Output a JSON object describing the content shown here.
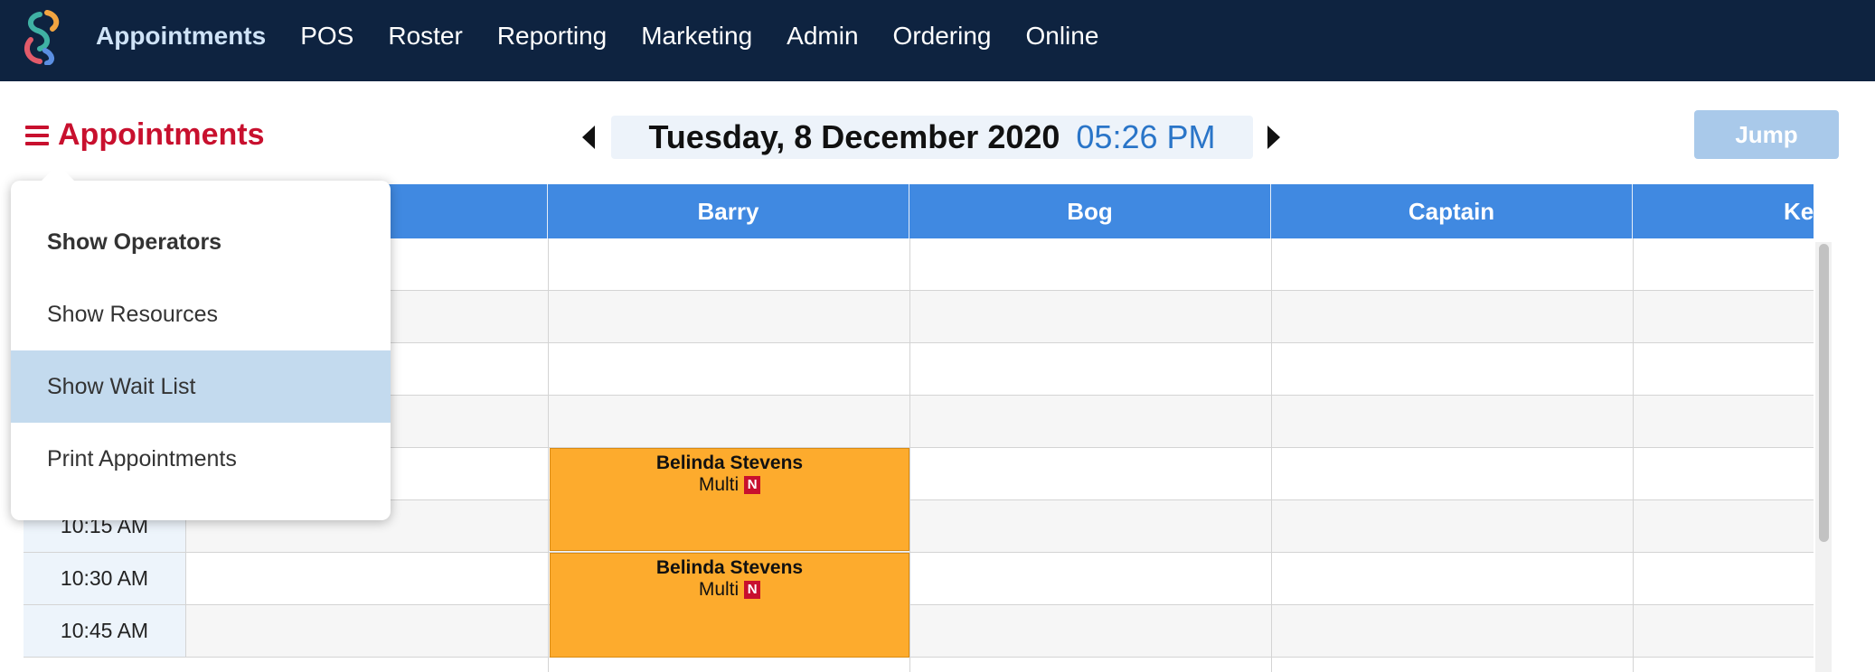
{
  "nav": {
    "items": [
      {
        "label": "Appointments",
        "active": true
      },
      {
        "label": "POS"
      },
      {
        "label": "Roster"
      },
      {
        "label": "Reporting"
      },
      {
        "label": "Marketing"
      },
      {
        "label": "Admin"
      },
      {
        "label": "Ordering"
      },
      {
        "label": "Online"
      }
    ]
  },
  "header": {
    "title": "Appointments",
    "date": "Tuesday, 8 December 2020",
    "time": "05:26 PM",
    "jump_label": "Jump"
  },
  "dropdown": {
    "items": [
      {
        "label": "Show Operators",
        "bold": true
      },
      {
        "label": "Show Resources"
      },
      {
        "label": "Show Wait List",
        "highlighted": true
      },
      {
        "label": "Print Appointments"
      }
    ]
  },
  "calendar": {
    "columns": [
      "",
      "Barry",
      "Bog",
      "Captain",
      "Keith"
    ],
    "times": [
      "",
      "",
      "",
      "",
      "",
      "10:15 AM",
      "10:30 AM",
      "10:45 AM"
    ],
    "appointments": [
      {
        "operator": "Barry",
        "client": "Belinda Stevens",
        "service": "Multi",
        "badge": "N"
      },
      {
        "operator": "Barry",
        "client": "Belinda Stevens",
        "service": "Multi",
        "badge": "N"
      }
    ]
  },
  "colors": {
    "nav_bg": "#0e2340",
    "accent_red": "#c8102e",
    "column_header": "#4089e1",
    "time_blue": "#2a75c8",
    "appointment": "#fdab2d",
    "jump_button": "#a9c9ea"
  }
}
